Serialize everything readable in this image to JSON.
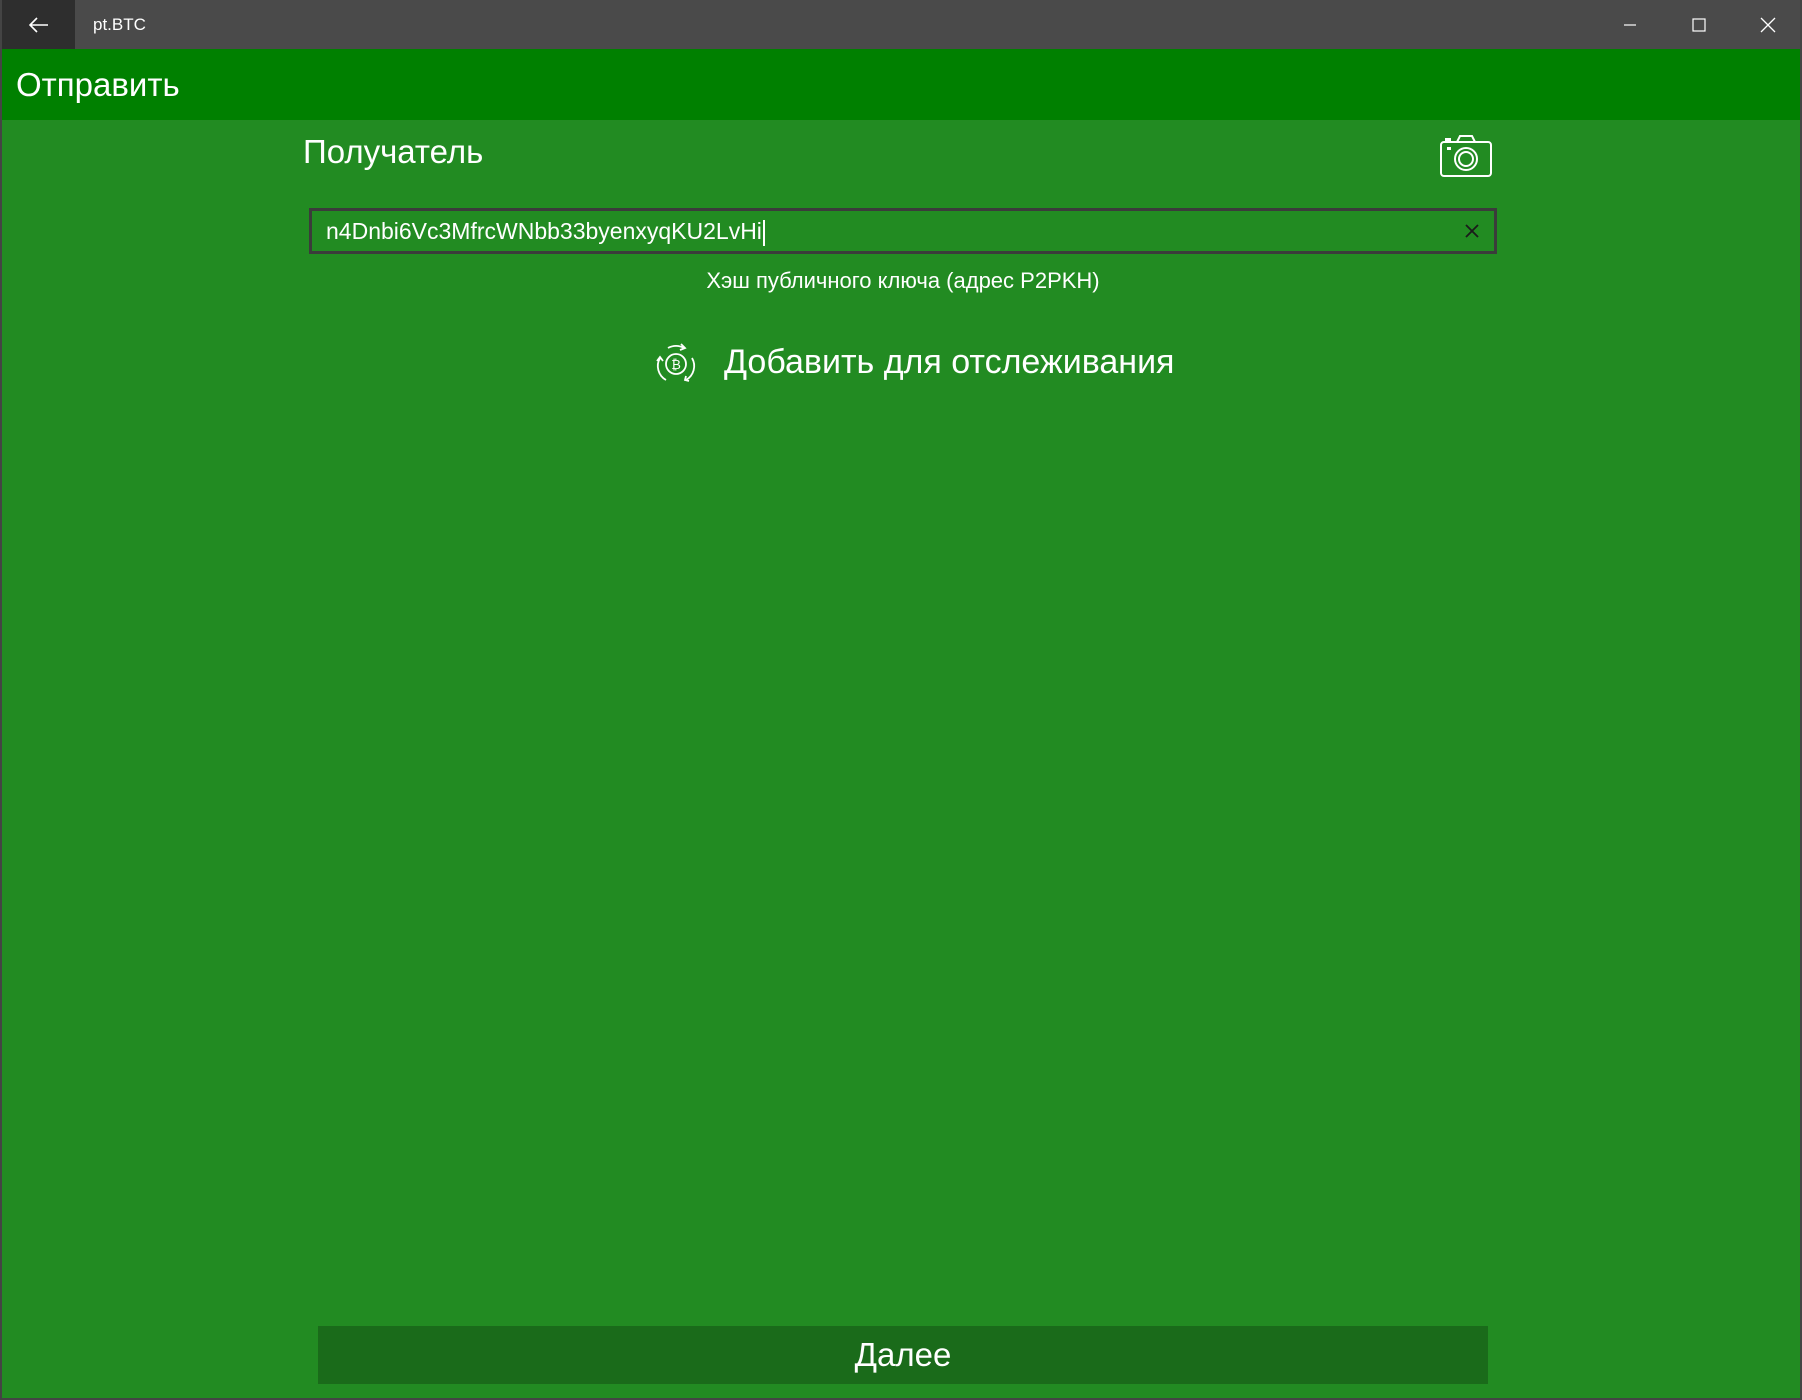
{
  "window": {
    "app_title": "pt.BTC",
    "back_icon": "arrow-left-icon",
    "minimize_icon": "minimize-icon",
    "maximize_icon": "maximize-icon",
    "close_icon": "close-icon"
  },
  "header": {
    "title": "Отправить",
    "accent_color": "#008000"
  },
  "recipient": {
    "label": "Получатель",
    "camera_icon": "camera-icon",
    "address_value": "n4Dnbi6Vc3MfrcWNbb33byenxyqKU2LvHi",
    "clear_icon": "close-icon",
    "address_type": "Хэш публичного ключа (адрес P2PKH)"
  },
  "watch": {
    "icon": "bitcoin-recycle-icon",
    "label": "Добавить для отслеживания"
  },
  "footer": {
    "next_label": "Далее"
  },
  "colors": {
    "background": "#228B22",
    "header": "#008000",
    "titlebar": "#4a4a4a",
    "button": "#1a6b1a"
  }
}
